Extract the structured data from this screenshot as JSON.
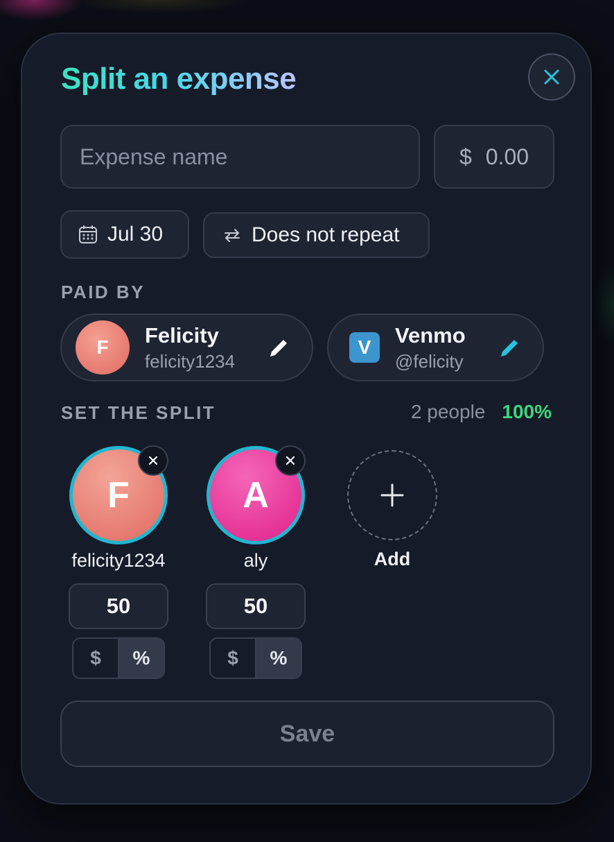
{
  "modal": {
    "title": "Split an expense"
  },
  "expense": {
    "name_placeholder": "Expense name",
    "currency_symbol": "$",
    "amount": "0.00",
    "date": "Jul 30",
    "repeat": "Does not repeat"
  },
  "paid_by": {
    "label": "PAID BY",
    "payer": {
      "initial": "F",
      "name": "Felicity",
      "username": "felicity1234"
    },
    "method": {
      "logo_letter": "V",
      "name": "Venmo",
      "handle": "@felicity"
    }
  },
  "split": {
    "label": "SET THE SPLIT",
    "people_count": "2 people",
    "total_percent": "100%",
    "members": [
      {
        "initial": "F",
        "name": "felicity1234",
        "share": "50",
        "mode_dollar": "$",
        "mode_percent": "%"
      },
      {
        "initial": "A",
        "name": "aly",
        "share": "50",
        "mode_dollar": "$",
        "mode_percent": "%"
      }
    ],
    "add_label": "Add"
  },
  "actions": {
    "save_label": "Save"
  },
  "colors": {
    "accent_cyan": "#22b6d0",
    "percent_green": "#3fd57a",
    "venmo_blue": "#3d95ce"
  },
  "icons": [
    "close-icon",
    "calendar-icon",
    "repeat-icon",
    "pencil-icon",
    "remove-icon",
    "plus-icon"
  ]
}
